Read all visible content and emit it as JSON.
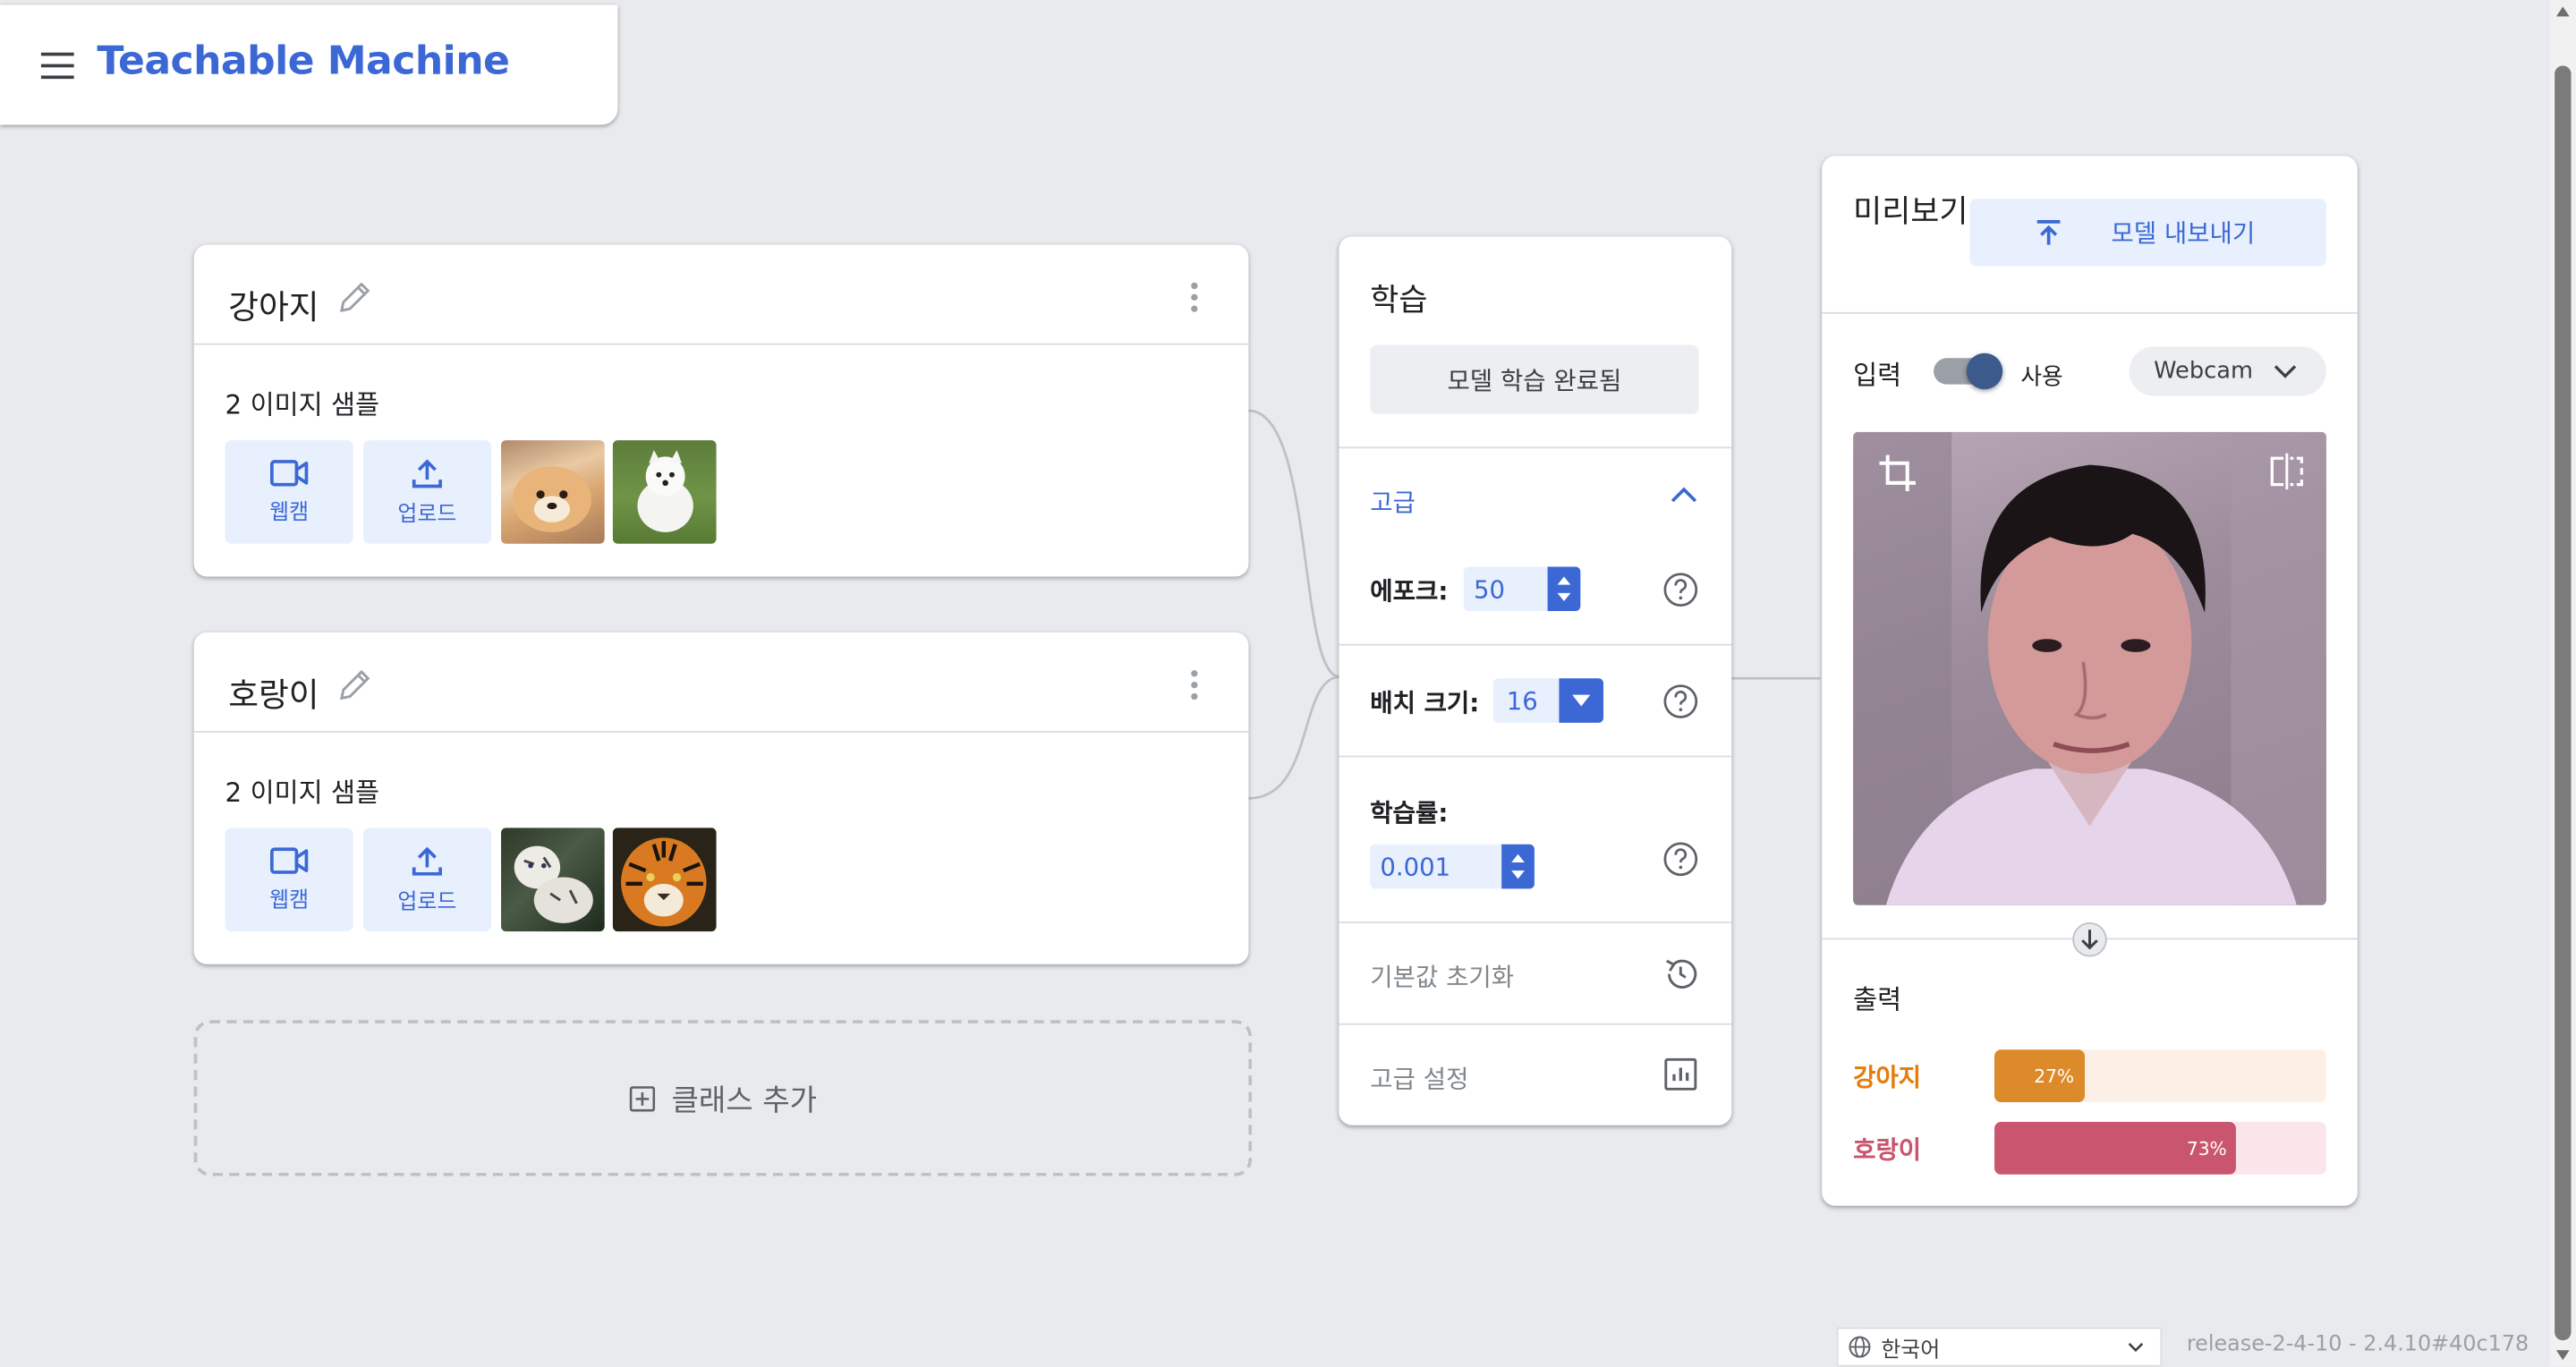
{
  "header": {
    "app_title": "Teachable Machine",
    "menu_icon": "menu-icon"
  },
  "classes": [
    {
      "name": "강아지",
      "samples_text": "2 이미지 샘플",
      "webcam_label": "웹캠",
      "upload_label": "업로드",
      "thumbnails": [
        "dog-photo-1",
        "dog-photo-2"
      ]
    },
    {
      "name": "호랑이",
      "samples_text": "2 이미지 샘플",
      "webcam_label": "웹캠",
      "upload_label": "업로드",
      "thumbnails": [
        "tiger-photo-1",
        "tiger-photo-2"
      ]
    }
  ],
  "add_class_label": "클래스 추가",
  "training": {
    "title": "학습",
    "train_button": "모델 학습 완료됨",
    "advanced_label": "고급",
    "epochs_label": "에포크:",
    "epochs_value": "50",
    "batch_label": "배치 크기:",
    "batch_value": "16",
    "lr_label": "학습률:",
    "lr_value": "0.001",
    "reset_label": "기본값 초기화",
    "advanced_settings_label": "고급 설정"
  },
  "preview": {
    "title": "미리보기",
    "export_button": "모델 내보내기",
    "input_label": "입력",
    "toggle_label": "사용",
    "toggle_on": true,
    "source_select": "Webcam",
    "output_label": "출력",
    "outputs": [
      {
        "label": "강아지",
        "percent_text": "27%",
        "fraction": 0.27,
        "color": "#e67c0e",
        "bg": "#fcefe6"
      },
      {
        "label": "호랑이",
        "percent_text": "73%",
        "fraction": 0.73,
        "color": "#c9566e",
        "bg": "#fae6ea"
      }
    ]
  },
  "footer": {
    "language": "한국어",
    "version": "release-2-4-10 - 2.4.10#40c178"
  },
  "colors": {
    "accent": "#3c68d5",
    "background": "#e8eaed"
  }
}
